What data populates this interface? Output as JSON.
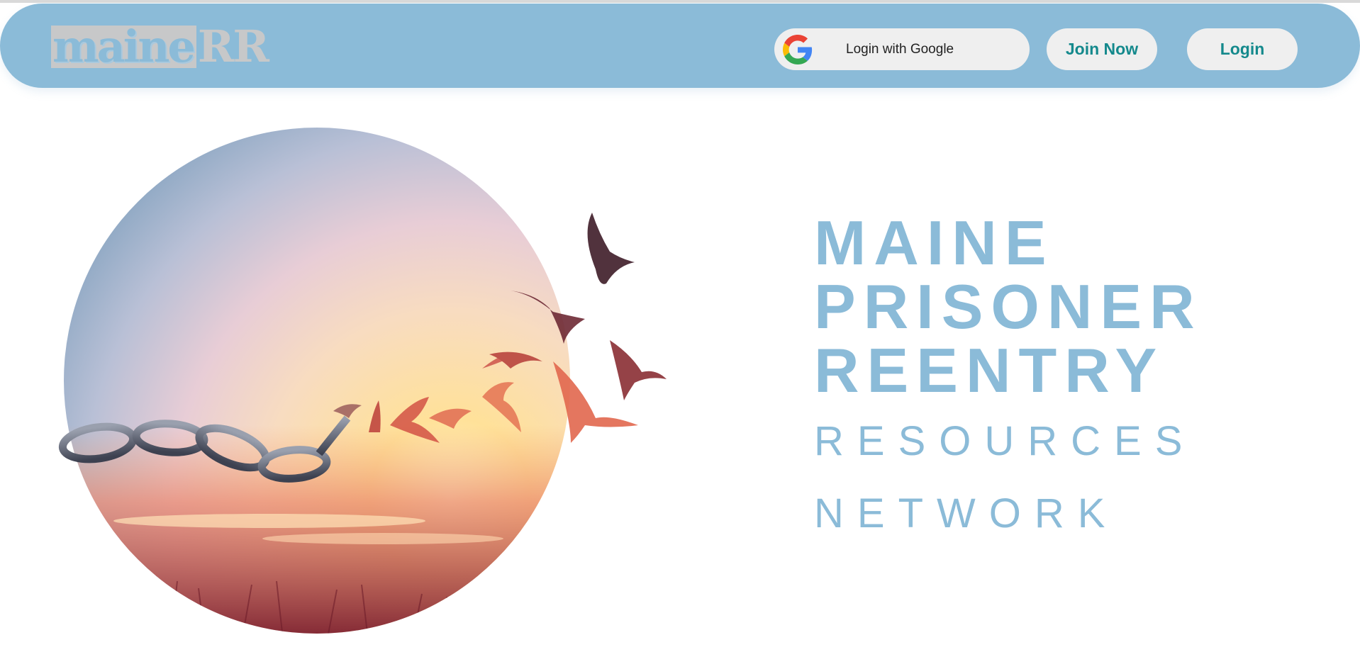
{
  "header": {
    "logo_main": "maine",
    "logo_suffix": "RR",
    "google_login_label": "Login with Google",
    "join_label": "Join Now",
    "login_label": "Login"
  },
  "hero": {
    "line1": "MAINE",
    "line2": "PRISONER",
    "line3": "REENTRY",
    "line4": "RESOURCES",
    "line5": "NETWORK"
  },
  "colors": {
    "brand_blue": "#8bbbd8",
    "button_bg": "#efefef",
    "button_text": "#14898c",
    "logo_gray": "#c7c8c9"
  },
  "icons": {
    "google": "google-g-icon"
  }
}
